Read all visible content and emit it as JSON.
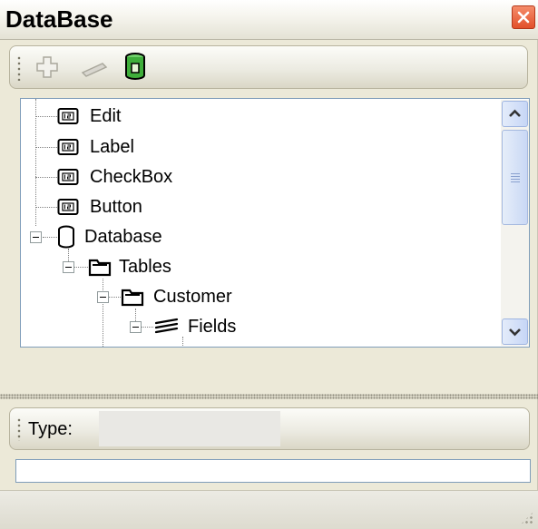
{
  "window": {
    "title": "DataBase"
  },
  "toolbar": {
    "icons": [
      "add-icon",
      "remove-icon",
      "database-icon"
    ]
  },
  "tree": {
    "nodes": [
      {
        "label": "Edit",
        "icon": "field-icon"
      },
      {
        "label": "Label",
        "icon": "field-icon"
      },
      {
        "label": "CheckBox",
        "icon": "field-icon"
      },
      {
        "label": "Button",
        "icon": "field-icon"
      },
      {
        "label": "Database",
        "icon": "database-icon"
      },
      {
        "label": "Tables",
        "icon": "folder-icon"
      },
      {
        "label": "Customer",
        "icon": "folder-icon"
      },
      {
        "label": "Fields",
        "icon": "fields-icon"
      }
    ]
  },
  "properties": {
    "type_label": "Type:",
    "type_value": "",
    "text_value": ""
  },
  "colors": {
    "panel_bg": "#ece9d8",
    "tree_border": "#7f9db9",
    "close_button": "#e2502a",
    "scrollbar_blue": "#c6d6f6"
  }
}
